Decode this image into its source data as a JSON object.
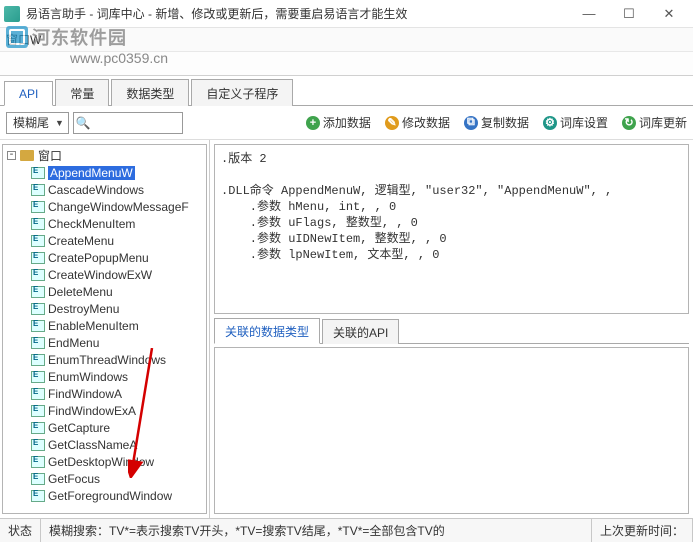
{
  "window": {
    "title": "易语言助手 - 词库中心 - 新增、修改或更新后，需要重启易语言才能生效",
    "doc_label": "窗口W"
  },
  "watermark": {
    "text": "河东软件园",
    "url": "www.pc0359.cn"
  },
  "tabs": {
    "items": [
      "API",
      "常量",
      "数据类型",
      "自定义子程序"
    ],
    "active_index": 0
  },
  "search": {
    "mode": "模糊尾",
    "value": ""
  },
  "actions": {
    "add": "添加数据",
    "edit": "修改数据",
    "copy": "复制数据",
    "settings": "词库设置",
    "update": "词库更新"
  },
  "tree": {
    "root": "窗口",
    "items": [
      "AppendMenuW",
      "CascadeWindows",
      "ChangeWindowMessageF",
      "CheckMenuItem",
      "CreateMenu",
      "CreatePopupMenu",
      "CreateWindowExW",
      "DeleteMenu",
      "DestroyMenu",
      "EnableMenuItem",
      "EndMenu",
      "EnumThreadWindows",
      "EnumWindows",
      "FindWindowA",
      "FindWindowExA",
      "GetCapture",
      "GetClassNameA",
      "GetDesktopWindow",
      "GetFocus",
      "GetForegroundWindow"
    ],
    "selected_index": 0
  },
  "code": {
    "text": ".版本 2\n\n.DLL命令 AppendMenuW, 逻辑型, \"user32\", \"AppendMenuW\", ,\n    .参数 hMenu, int, , 0\n    .参数 uFlags, 整数型, , 0\n    .参数 uIDNewItem, 整数型, , 0\n    .参数 lpNewItem, 文本型, , 0"
  },
  "related_tabs": {
    "items": [
      "关联的数据类型",
      "关联的API"
    ],
    "active_index": 0
  },
  "status": {
    "label": "状态",
    "hint": "模糊搜索：TV*=表示搜索TV开头，*TV=搜索TV结尾，*TV*=全部包含TV的",
    "last_update_label": "上次更新时间：",
    "last_update_value": ""
  }
}
